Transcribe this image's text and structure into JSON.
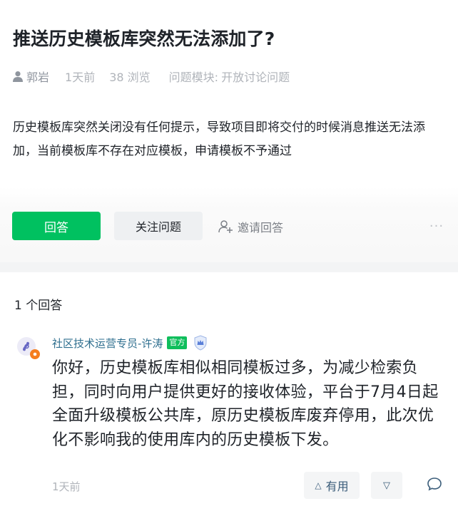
{
  "question": {
    "title": "推送历史模板库突然无法添加了?",
    "author": "郭岩",
    "time": "1天前",
    "views": "38 浏览",
    "module_label": "问题模块:",
    "module_value": "开放讨论问题",
    "body": "历史模板库突然关闭没有任何提示，导致项目即将交付的时候消息推送无法添加，当前模板库不存在对应模板，申请模板不予通过"
  },
  "actions": {
    "answer_label": "回答",
    "follow_label": "关注问题",
    "invite_label": "邀请回答",
    "more_label": "···"
  },
  "answers": {
    "count_label": "1 个回答",
    "items": [
      {
        "author": "社区技术运营专员-许涛",
        "badge": "官方",
        "text": "你好，历史模板库相似相同模板过多，为减少检索负担，同时向用户提供更好的接收体验，平台于7月4日起全面升级模板公共库，原历史模板库废弃停用，此次优化不影响我的使用库内的历史模板下发。",
        "time": "1天前",
        "useful_label": "有用",
        "useful_icon": "△",
        "down_icon": "▽"
      }
    ]
  },
  "colors": {
    "brand_green": "#00c160",
    "badge_green": "#0fbe5c",
    "author_link": "#2f6f8f",
    "muted": "#b0b4ba"
  },
  "icons": {
    "user": "user-icon",
    "invite": "add-user-icon",
    "shield": "shield-crown-icon",
    "comment": "comment-bubble-icon",
    "avatar": "mini-program-logo"
  }
}
